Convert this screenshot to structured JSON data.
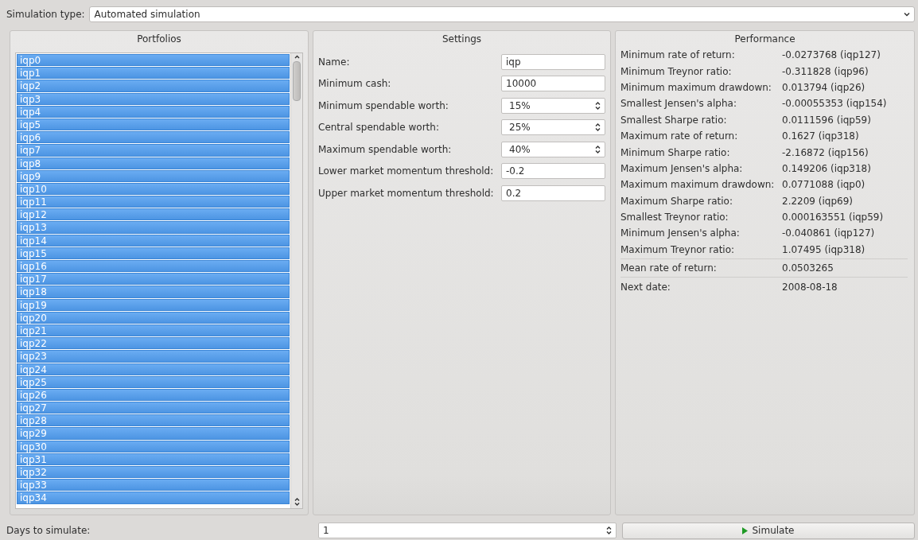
{
  "simulation_type": {
    "label": "Simulation type:",
    "value": "Automated simulation"
  },
  "portfolios": {
    "title": "Portfolios",
    "items": [
      {
        "label": "iqp0",
        "selected": true
      },
      {
        "label": "iqp1",
        "selected": true
      },
      {
        "label": "iqp2",
        "selected": true
      },
      {
        "label": "iqp3",
        "selected": true
      },
      {
        "label": "iqp4",
        "selected": true
      },
      {
        "label": "iqp5",
        "selected": true
      },
      {
        "label": "iqp6",
        "selected": true
      },
      {
        "label": "iqp7",
        "selected": true
      },
      {
        "label": "iqp8",
        "selected": true
      },
      {
        "label": "iqp9",
        "selected": true
      },
      {
        "label": "iqp10",
        "selected": true
      },
      {
        "label": "iqp11",
        "selected": true
      },
      {
        "label": "iqp12",
        "selected": true
      },
      {
        "label": "iqp13",
        "selected": true
      },
      {
        "label": "iqp14",
        "selected": true
      },
      {
        "label": "iqp15",
        "selected": true
      },
      {
        "label": "iqp16",
        "selected": true
      },
      {
        "label": "iqp17",
        "selected": true
      },
      {
        "label": "iqp18",
        "selected": true
      },
      {
        "label": "iqp19",
        "selected": true
      },
      {
        "label": "iqp20",
        "selected": true
      },
      {
        "label": "iqp21",
        "selected": true
      },
      {
        "label": "iqp22",
        "selected": true
      },
      {
        "label": "iqp23",
        "selected": true
      },
      {
        "label": "iqp24",
        "selected": true
      },
      {
        "label": "iqp25",
        "selected": true
      },
      {
        "label": "iqp26",
        "selected": true
      },
      {
        "label": "iqp27",
        "selected": true
      },
      {
        "label": "iqp28",
        "selected": true
      },
      {
        "label": "iqp29",
        "selected": true
      },
      {
        "label": "iqp30",
        "selected": true
      },
      {
        "label": "iqp31",
        "selected": true
      },
      {
        "label": "iqp32",
        "selected": true
      },
      {
        "label": "iqp33",
        "selected": true
      },
      {
        "label": "iqp34",
        "selected": true
      }
    ]
  },
  "settings": {
    "title": "Settings",
    "fields": [
      {
        "label": "Name:",
        "kind": "text",
        "value": "iqp"
      },
      {
        "label": "Minimum cash:",
        "kind": "text",
        "value": "10000"
      },
      {
        "label": "Minimum spendable worth:",
        "kind": "spin",
        "value": "15%"
      },
      {
        "label": "Central spendable worth:",
        "kind": "spin",
        "value": "25%"
      },
      {
        "label": "Maximum spendable worth:",
        "kind": "spin",
        "value": "40%"
      },
      {
        "label": "Lower market momentum threshold:",
        "kind": "text",
        "value": "-0.2"
      },
      {
        "label": "Upper market momentum threshold:",
        "kind": "text",
        "value": "0.2"
      }
    ]
  },
  "performance": {
    "title": "Performance",
    "groups": [
      [
        {
          "label": "Minimum rate of return:",
          "value": "-0.0273768 (iqp127)"
        },
        {
          "label": "Minimum Treynor ratio:",
          "value": "-0.311828 (iqp96)"
        },
        {
          "label": "Minimum maximum drawdown:",
          "value": "0.013794 (iqp26)"
        },
        {
          "label": "Smallest Jensen's alpha:",
          "value": "-0.00055353 (iqp154)"
        },
        {
          "label": "Smallest Sharpe ratio:",
          "value": "0.0111596 (iqp59)"
        },
        {
          "label": "Maximum rate of return:",
          "value": "0.1627 (iqp318)"
        },
        {
          "label": "Minimum Sharpe ratio:",
          "value": "-2.16872 (iqp156)"
        },
        {
          "label": "Maximum Jensen's alpha:",
          "value": "0.149206 (iqp318)"
        },
        {
          "label": "Maximum maximum drawdown:",
          "value": "0.0771088 (iqp0)"
        },
        {
          "label": "Maximum Sharpe ratio:",
          "value": "2.2209 (iqp69)"
        },
        {
          "label": "Smallest Treynor ratio:",
          "value": "0.000163551 (iqp59)"
        },
        {
          "label": "Minimum Jensen's alpha:",
          "value": "-0.040861 (iqp127)"
        },
        {
          "label": "Maximum Treynor ratio:",
          "value": "1.07495 (iqp318)"
        }
      ],
      [
        {
          "label": "Mean rate of return:",
          "value": "0.0503265"
        }
      ],
      [
        {
          "label": "Next date:",
          "value": "2008-08-18"
        }
      ]
    ]
  },
  "days": {
    "label": "Days to simulate:",
    "value": "1"
  },
  "simulate_button": {
    "label": "Simulate"
  }
}
